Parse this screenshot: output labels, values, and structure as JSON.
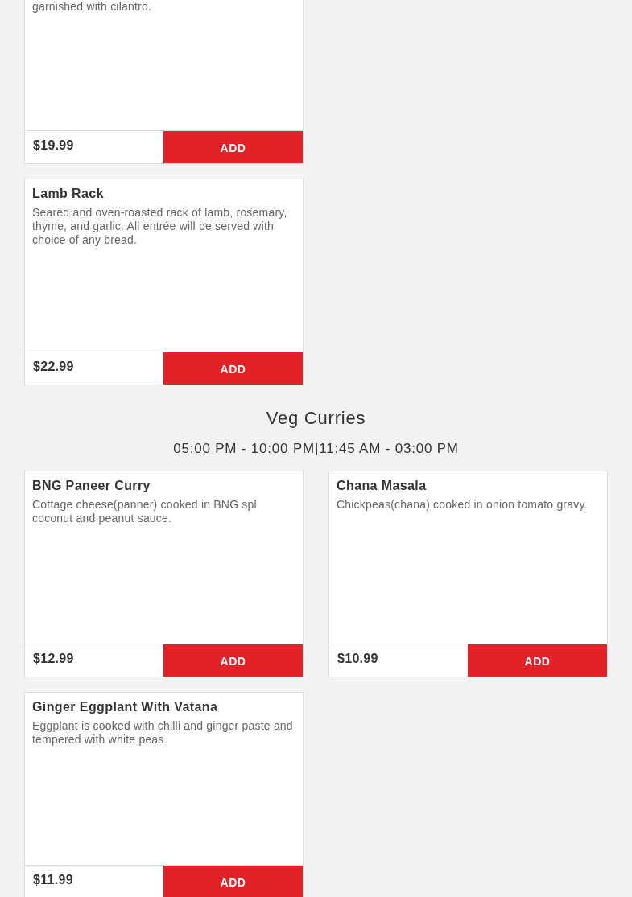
{
  "sections": [
    {
      "items": [
        {
          "kind": "cut",
          "description": "garnished with cilantro.",
          "price": "$19.99",
          "button": "ADD"
        },
        {
          "kind": "full",
          "name": "Lamb Rack",
          "description": "Seared and oven-roasted rack of lamb, rosemary, thyme, and garlic. All entrée will be served with choice of any bread.",
          "price": "$22.99",
          "button": "ADD"
        }
      ]
    },
    {
      "title": "Veg Curries",
      "hours": "05:00 PM - 10:00 PM|11:45 AM - 03:00 PM",
      "items": [
        {
          "kind": "full",
          "name": "BNG Paneer Curry",
          "description": "Cottage cheese(panner) cooked in BNG spl coconut and peanut sauce.",
          "price": "$12.99",
          "button": "ADD"
        },
        {
          "kind": "full",
          "name": "Chana Masala",
          "description": "Chickpeas(chana) cooked in onion tomato gravy.",
          "price": "$10.99",
          "button": "ADD"
        },
        {
          "kind": "full",
          "name": "Ginger Eggplant With Vatana",
          "description": "Eggplant is cooked with chilli and ginger paste and tempered with white peas.",
          "price": "$11.99",
          "button": "ADD"
        }
      ]
    }
  ]
}
